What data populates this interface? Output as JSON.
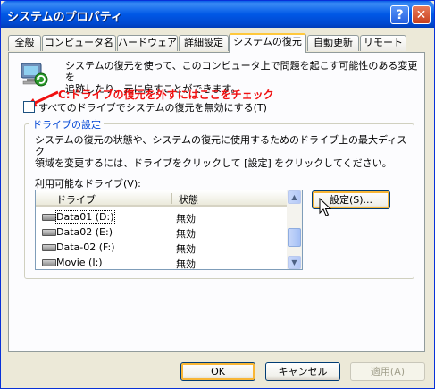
{
  "window": {
    "title": "システムのプロパティ",
    "help_label": "?",
    "close_label": "✕"
  },
  "tabs": [
    {
      "label": "全般",
      "active": false
    },
    {
      "label": "コンピュータ名",
      "active": false
    },
    {
      "label": "ハードウェア",
      "active": false
    },
    {
      "label": "詳細設定",
      "active": false
    },
    {
      "label": "システムの復元",
      "active": true
    },
    {
      "label": "自動更新",
      "active": false
    },
    {
      "label": "リモート",
      "active": false
    }
  ],
  "restore": {
    "icon": "system-restore-icon",
    "description": "システムの復元を使って、このコンピュータ上で問題を起こす可能性のある変更を\n追跡したり、元に戻すことができます。",
    "disable_all_label": "すべてのドライブでシステムの復元を無効にする(T)",
    "disable_all_checked": false
  },
  "annotation": {
    "callout": "C:ドライブの復元を外すにはここをチェック",
    "color": "#f01010"
  },
  "drive_settings": {
    "legend": "ドライブの設定",
    "description": "システムの復元の状態や、システムの復元に使用するためのドライブ上の最大ディスク\n領域を変更するには、ドライブをクリックして [設定] をクリックしてください。",
    "list_label": "利用可能なドライブ(V):",
    "columns": {
      "drive": "ドライブ",
      "status": "状態"
    },
    "drives": [
      {
        "name": "Data01 (D:)",
        "status": "無効",
        "selected": true
      },
      {
        "name": "Data02 (E:)",
        "status": "無効",
        "selected": false
      },
      {
        "name": "Data-02 (F:)",
        "status": "無効",
        "selected": false
      },
      {
        "name": "Movie (I:)",
        "status": "無効",
        "selected": false
      }
    ],
    "settings_button": "設定(S)..."
  },
  "footer": {
    "ok": "OK",
    "cancel": "キャンセル",
    "apply": "適用(A)"
  },
  "colors": {
    "titlebar": "#0058e6",
    "dialog_bg": "#ece9d8",
    "accent_tab": "#ffc83c",
    "group_legend": "#0046d5"
  }
}
